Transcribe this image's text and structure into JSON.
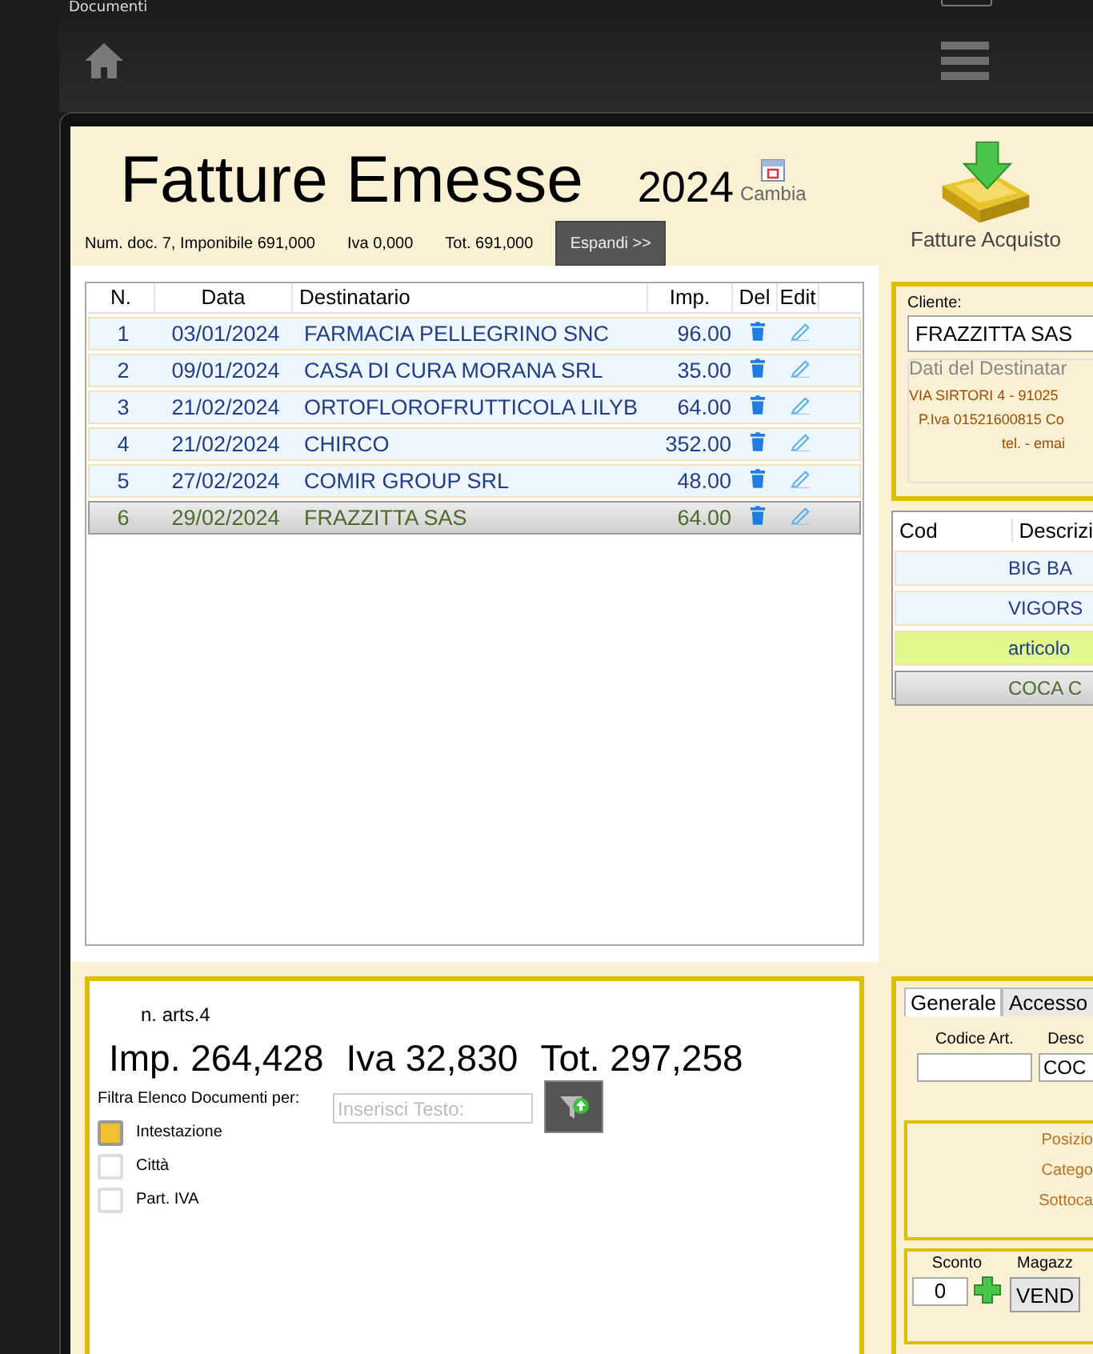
{
  "app": {
    "title": "Documenti"
  },
  "header": {
    "title": "Fatture Emesse",
    "year": "2024",
    "change_year": "Cambia",
    "summary": [
      "Num. doc. 7, Imponibile 691,000",
      "Iva 0,000",
      "Tot. 691,000"
    ],
    "expand_button": "Espandi >>",
    "purchase_invoices": "Fatture Acquisto"
  },
  "documents": {
    "columns": [
      "N.",
      "Data",
      "Destinatario",
      "Imp.",
      "Del",
      "Edit"
    ],
    "rows": [
      {
        "n": "1",
        "date": "03/01/2024",
        "recipient": "FARMACIA PELLEGRINO SNC",
        "amount": "96.00",
        "selected": false
      },
      {
        "n": "2",
        "date": "09/01/2024",
        "recipient": "CASA DI CURA MORANA SRL",
        "amount": "35.00",
        "selected": false
      },
      {
        "n": "3",
        "date": "21/02/2024",
        "recipient": "ORTOFLOROFRUTTICOLA LILYB",
        "amount": "64.00",
        "selected": false
      },
      {
        "n": "4",
        "date": "21/02/2024",
        "recipient": "CHIRCO",
        "amount": "352.00",
        "selected": false
      },
      {
        "n": "5",
        "date": "27/02/2024",
        "recipient": "COMIR GROUP SRL",
        "amount": "48.00",
        "selected": false
      },
      {
        "n": "6",
        "date": "29/02/2024",
        "recipient": "FRAZZITTA SAS",
        "amount": "64.00",
        "selected": true
      }
    ]
  },
  "totals": {
    "article_count": "n. arts.4",
    "items": [
      "Imp. 264,428",
      "Iva 32,830",
      "Tot. 297,258"
    ]
  },
  "filter": {
    "label": "Filtra Elenco Documenti per:",
    "placeholder": "Inserisci Testo:",
    "options": [
      {
        "label": "Intestazione",
        "checked": true
      },
      {
        "label": "Città",
        "checked": false
      },
      {
        "label": "Part. IVA",
        "checked": false
      }
    ]
  },
  "client": {
    "label": "Cliente:",
    "value": "FRAZZITTA SAS",
    "recipient_legend": "Dati del Destinatar",
    "lines": [
      "VIA SIRTORI 4 - 91025",
      "P.Iva 01521600815 Co",
      "tel.  - emai"
    ]
  },
  "articles": {
    "columns": [
      "Cod",
      "Descrizi"
    ],
    "rows": [
      {
        "description": "BIG BA",
        "highlighted": false,
        "selected": false
      },
      {
        "description": "VIGORS",
        "highlighted": false,
        "selected": false
      },
      {
        "description": "articolo",
        "highlighted": true,
        "selected": false
      },
      {
        "description": "COCA C",
        "highlighted": false,
        "selected": true
      }
    ]
  },
  "detail": {
    "tabs": [
      {
        "label": "Generale",
        "selected": true
      },
      {
        "label": "Accesso",
        "selected": false
      }
    ],
    "code_label": "Codice Art.",
    "description_label": "Desc",
    "description_value": "COC",
    "classification": [
      "Posizio",
      "Catego",
      "Sottoca"
    ],
    "discount_label": "Sconto",
    "discount_value": "0",
    "warehouse_label": "Magazz",
    "warehouse_button": "VEND"
  }
}
